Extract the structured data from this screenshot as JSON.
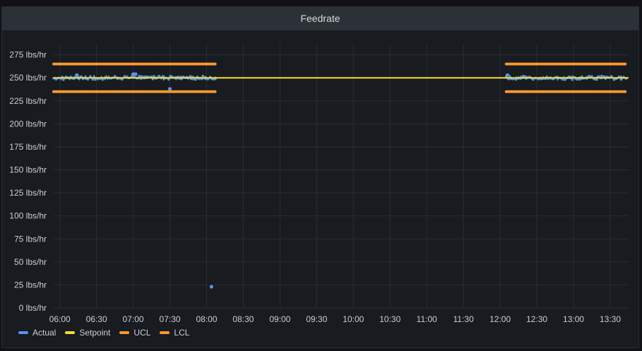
{
  "panel": {
    "title": "Feedrate"
  },
  "colors": {
    "actual": "#5794f2",
    "setpoint": "#fade2a",
    "ucl": "#ff9830",
    "lcl": "#ff9830",
    "grid": "#2a2d33",
    "tick_text": "#ccccdc"
  },
  "chart_data": {
    "type": "scatter",
    "title": "Feedrate",
    "xlabel": "",
    "ylabel": "",
    "y_unit": "lbs/hr",
    "x_unit": "minutes of day",
    "xlim": [
      "05:55",
      "13:45"
    ],
    "ylim": [
      0,
      287
    ],
    "y_ticks": [
      "0 lbs/hr",
      "25 lbs/hr",
      "50 lbs/hr",
      "75 lbs/hr",
      "100 lbs/hr",
      "125 lbs/hr",
      "150 lbs/hr",
      "175 lbs/hr",
      "200 lbs/hr",
      "225 lbs/hr",
      "250 lbs/hr",
      "275 lbs/hr"
    ],
    "y_tick_values": [
      0,
      25,
      50,
      75,
      100,
      125,
      150,
      175,
      200,
      225,
      250,
      275
    ],
    "x_ticks": [
      "06:00",
      "06:30",
      "07:00",
      "07:30",
      "08:00",
      "08:30",
      "09:00",
      "09:30",
      "10:00",
      "10:30",
      "11:00",
      "11:30",
      "12:00",
      "12:30",
      "13:00",
      "13:30"
    ],
    "grid": true,
    "legend_position": "bottom-left",
    "segments": [
      {
        "start": "05:55",
        "end": "08:08"
      },
      {
        "start": "12:05",
        "end": "13:43"
      }
    ],
    "series": [
      {
        "name": "Actual",
        "color_key": "actual",
        "nominal": 250,
        "jitter": 2,
        "outliers": [
          {
            "x": "06:14",
            "y": 253
          },
          {
            "x": "07:00",
            "y": 254
          },
          {
            "x": "07:02",
            "y": 254
          },
          {
            "x": "07:30",
            "y": 238
          },
          {
            "x": "08:04",
            "y": 23
          },
          {
            "x": "12:06",
            "y": 253
          }
        ]
      },
      {
        "name": "Setpoint",
        "color_key": "setpoint",
        "value": 250,
        "continuous": true
      },
      {
        "name": "UCL",
        "color_key": "ucl",
        "value": 265
      },
      {
        "name": "LCL",
        "color_key": "lcl",
        "value": 235
      }
    ]
  }
}
